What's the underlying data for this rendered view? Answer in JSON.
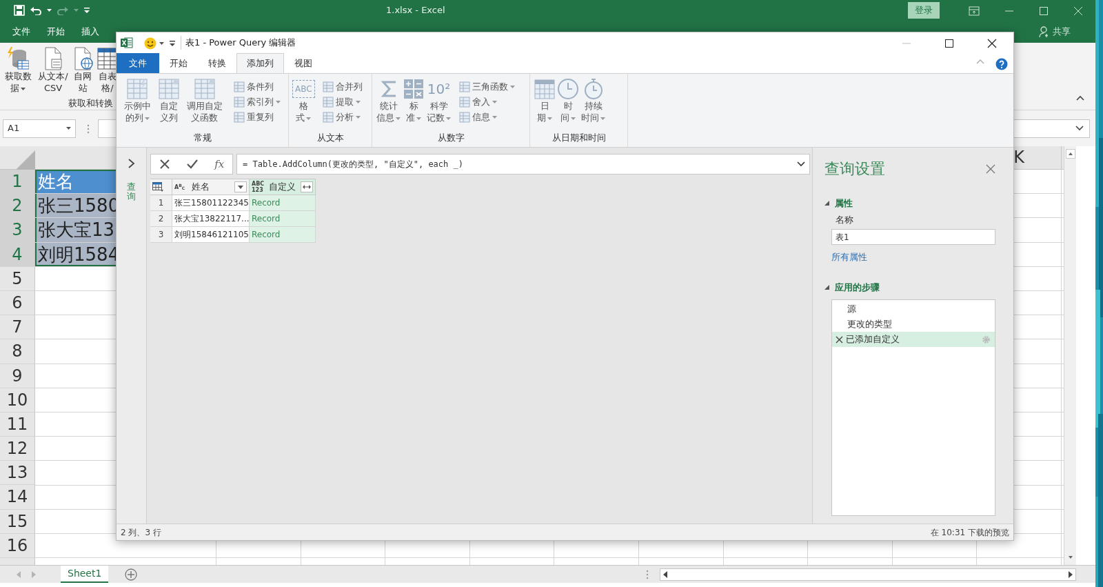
{
  "excel": {
    "title": "1.xlsx - Excel",
    "sign_in": "登录",
    "share": "共享",
    "tabs": [
      {
        "label": "文件",
        "kind": "tab",
        "selected": false
      },
      {
        "label": "开始",
        "kind": "tab",
        "selected": false
      },
      {
        "label": "插入",
        "kind": "tab",
        "selected": false
      }
    ],
    "ribbon_buttons": [
      {
        "label": "获取数据",
        "dropdown": true
      },
      {
        "label": "从文本/CSV",
        "dropdown": false
      },
      {
        "label": "自网站",
        "dropdown": false
      },
      {
        "label": "自表格/",
        "dropdown": false
      }
    ],
    "ribbon_group": "获取和转换",
    "name_box": "A1",
    "column_header": "K",
    "rows": [
      {
        "number": "1",
        "cell": "姓名",
        "kind": "header",
        "selected": true
      },
      {
        "number": "2",
        "cell": "张三1580",
        "kind": "data",
        "selected": true
      },
      {
        "number": "3",
        "cell": "张大宝13",
        "kind": "data",
        "selected": true
      },
      {
        "number": "4",
        "cell": "刘明1584",
        "kind": "data",
        "selected": true
      },
      {
        "number": "5",
        "selected": false
      },
      {
        "number": "6",
        "selected": false
      },
      {
        "number": "7",
        "selected": false
      },
      {
        "number": "8",
        "selected": false
      },
      {
        "number": "9",
        "selected": false
      },
      {
        "number": "10",
        "selected": false
      },
      {
        "number": "11",
        "selected": false
      },
      {
        "number": "12",
        "selected": false
      },
      {
        "number": "13",
        "selected": false
      },
      {
        "number": "14",
        "selected": false
      },
      {
        "number": "15",
        "selected": false
      },
      {
        "number": "16",
        "selected": false
      }
    ],
    "sheet_tabs": [
      {
        "label": "Sheet1",
        "selected": true
      }
    ]
  },
  "power_query": {
    "title": "表1 - Power Query 编辑器",
    "tabs": [
      {
        "label": "文件",
        "kind": "file",
        "selected": false
      },
      {
        "label": "开始",
        "kind": "tab",
        "selected": false
      },
      {
        "label": "转换",
        "kind": "tab",
        "selected": false
      },
      {
        "label": "添加列",
        "kind": "tab",
        "selected": true
      },
      {
        "label": "视图",
        "kind": "tab",
        "selected": false
      }
    ],
    "ribbon_groups": [
      {
        "label": "常规",
        "large": [
          {
            "label": "示例中的列",
            "dropdown": true
          },
          {
            "label": "自定义列",
            "dropdown": false
          },
          {
            "label": "调用自定义函数",
            "dropdown": false
          }
        ],
        "small": [
          {
            "label": "条件列",
            "dropdown": false
          },
          {
            "label": "索引列",
            "dropdown": true
          },
          {
            "label": "重复列",
            "dropdown": false
          }
        ]
      },
      {
        "label": "从文本",
        "large": [
          {
            "label": "格式",
            "dropdown": true,
            "icon_text": "ABC"
          }
        ],
        "small": [
          {
            "label": "合并列",
            "dropdown": false
          },
          {
            "label": "提取",
            "dropdown": true
          },
          {
            "label": "分析",
            "dropdown": true
          }
        ]
      },
      {
        "label": "从数字",
        "large": [
          {
            "label": "统计信息",
            "dropdown": true
          },
          {
            "label": "标准",
            "dropdown": true
          },
          {
            "label": "科学记数",
            "dropdown": true,
            "icon_text": "10²"
          }
        ],
        "small": [
          {
            "label": "三角函数",
            "dropdown": true
          },
          {
            "label": "舍入",
            "dropdown": true
          },
          {
            "label": "信息",
            "dropdown": true
          }
        ]
      },
      {
        "label": "从日期和时间",
        "large": [
          {
            "label": "日期",
            "dropdown": true
          },
          {
            "label": "时间",
            "dropdown": true
          },
          {
            "label": "持续时间",
            "dropdown": true
          }
        ]
      }
    ],
    "queries_pane": {
      "label": "查询",
      "expanded": false
    },
    "insert_function": "fx",
    "formula": "= Table.AddColumn(更改的类型, \"自定义\", each _)",
    "table": {
      "columns": [
        {
          "type_label": "A$^{B}$$_{C}$",
          "name": "姓名",
          "selected": false
        },
        {
          "type_label": "ABC 123",
          "name": "自定义",
          "selected": true
        }
      ],
      "rows": [
        {
          "number": "1",
          "cells": [
            "张三15801122345",
            "Record"
          ]
        },
        {
          "number": "2",
          "cells": [
            "张大宝13822117...",
            "Record"
          ]
        },
        {
          "number": "3",
          "cells": [
            "刘明15846121105",
            "Record"
          ]
        }
      ]
    },
    "settings": {
      "title": "查询设置",
      "properties_heading": "属性",
      "name_label": "名称",
      "name_value": "表1",
      "all_properties": "所有属性",
      "steps_heading": "应用的步骤",
      "steps": [
        {
          "label": "源",
          "selected": false
        },
        {
          "label": "更改的类型",
          "selected": false
        },
        {
          "label": "已添加自定义",
          "selected": true
        }
      ]
    },
    "status": "2 列、3 行",
    "preview_status": "在 10:31 下载的预览"
  }
}
